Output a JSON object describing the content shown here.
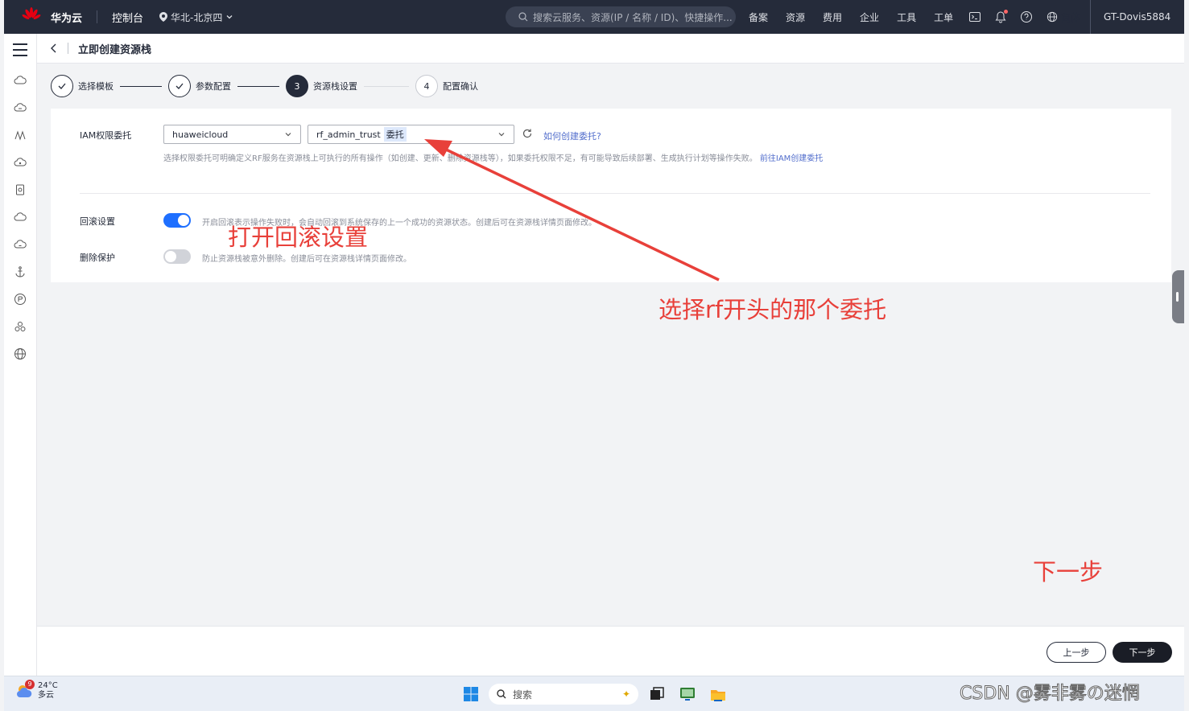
{
  "topbar": {
    "brand": "华为云",
    "console": "控制台",
    "region": "华北-北京四",
    "search_placeholder": "搜索云服务、资源(IP / 名称 / ID)、快捷操作...",
    "nav": [
      "备案",
      "资源",
      "费用",
      "企业",
      "工具",
      "工单"
    ],
    "language": "简体",
    "user": "GT-Dovis5884",
    "logo_text": "HUAWEI"
  },
  "page": {
    "title": "立即创建资源栈"
  },
  "steps": [
    {
      "label": "选择模板",
      "state": "done",
      "index": "1"
    },
    {
      "label": "参数配置",
      "state": "done",
      "index": "2"
    },
    {
      "label": "资源栈设置",
      "state": "active",
      "index": "3"
    },
    {
      "label": "配置确认",
      "state": "todo",
      "index": "4"
    }
  ],
  "form": {
    "iam_label": "IAM权限委托",
    "provider_value": "huaweicloud",
    "agency_value": "rf_admin_trust",
    "agency_tag": "委托",
    "how_link": "如何创建委托?",
    "hint_text": "选择权限委托可明确定义RF服务在资源栈上可执行的所有操作（如创建、更新、删除资源栈等），如果委托权限不足，有可能导致后续部署、生成执行计划等操作失败。",
    "hint_link": "前往IAM创建委托",
    "rollback_label": "回滚设置",
    "rollback_on": true,
    "rollback_desc": "开启回滚表示操作失败时，会自动回滚到系统保存的上一个成功的资源状态。创建后可在资源栈详情页面修改。",
    "delete_label": "删除保护",
    "delete_on": false,
    "delete_desc": "防止资源栈被意外删除。创建后可在资源栈详情页面修改。"
  },
  "footer": {
    "prev_label": "上一步",
    "next_label": "下一步"
  },
  "annotations": {
    "rollback_note": "打开回滚设置",
    "agency_note": "选择rf开头的那个委托",
    "next_note": "下一步",
    "color": "#e8403a"
  },
  "taskbar": {
    "temperature": "24°C",
    "weather": "多云",
    "weather_badge": "9",
    "search_label": "搜索"
  },
  "watermark": "CSDN @雾非雾の迷惘",
  "colors": {
    "topbar_bg": "#252b3a",
    "toggle_on": "#1e6fff",
    "link": "#526ecc"
  }
}
